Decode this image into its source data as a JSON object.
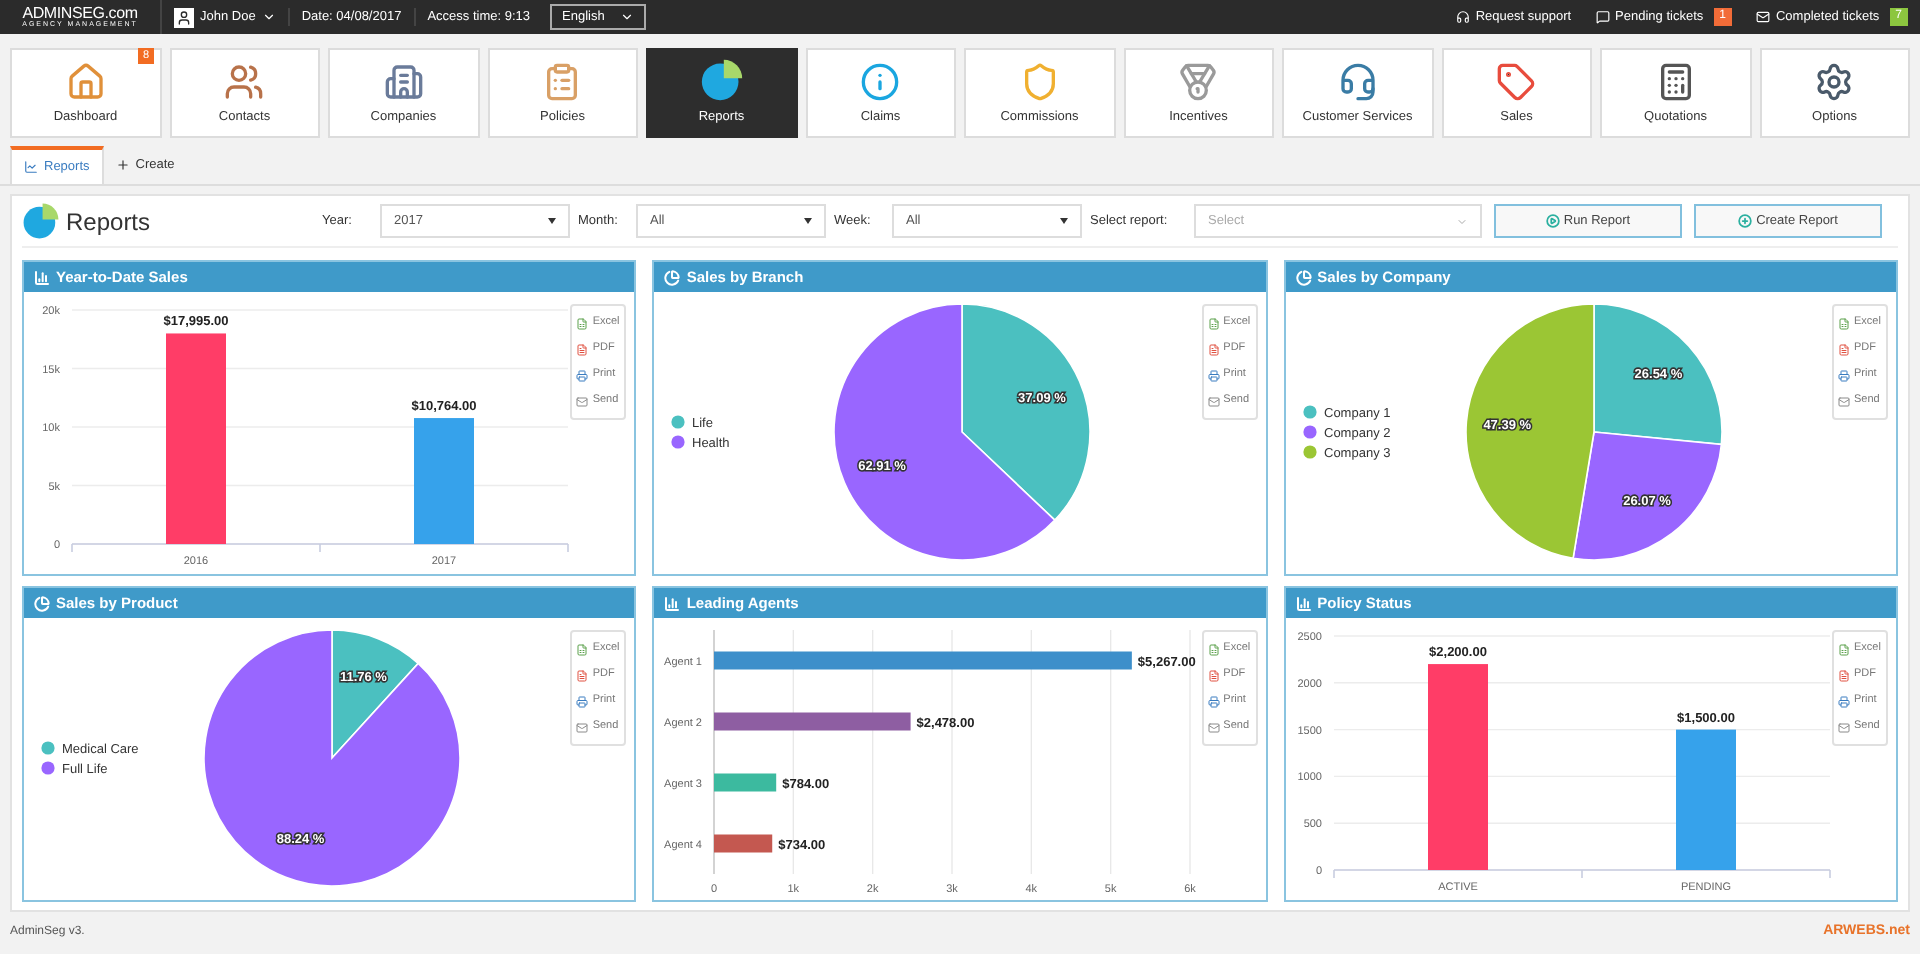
{
  "top_bar": {
    "logo": {
      "name": "ADMINSEG.com",
      "tagline": "AGENCY MANAGEMENT"
    },
    "user": "John Doe",
    "date": "Date: 04/08/2017",
    "access_time": "Access time: 9:13",
    "language": "English",
    "links": [
      {
        "label": "Request support"
      },
      {
        "label": "Pending tickets",
        "badge": "1",
        "color": "#f26c38"
      },
      {
        "label": "Completed tickets",
        "badge": "7",
        "color": "#8cc63f"
      }
    ]
  },
  "modules": [
    {
      "label": "Dashboard",
      "selected": false,
      "badge": "8"
    },
    {
      "label": "Contacts",
      "selected": false
    },
    {
      "label": "Companies",
      "selected": false
    },
    {
      "label": "Policies",
      "selected": false
    },
    {
      "label": "Reports",
      "selected": true
    },
    {
      "label": "Claims",
      "selected": false
    },
    {
      "label": "Commissions",
      "selected": false
    },
    {
      "label": "Incentives",
      "selected": false
    },
    {
      "label": "Customer Services",
      "selected": false
    },
    {
      "label": "Sales",
      "selected": false
    },
    {
      "label": "Quotations",
      "selected": false
    },
    {
      "label": "Options",
      "selected": false
    }
  ],
  "tabs": [
    {
      "label": "Reports",
      "selected": true
    },
    {
      "label": "Create",
      "selected": false
    }
  ],
  "page": {
    "title": "Reports",
    "filters": [
      {
        "label": "Year:",
        "value": "2017"
      },
      {
        "label": "Month:",
        "value": "All"
      },
      {
        "label": "Week:",
        "value": "All"
      }
    ],
    "report_select": {
      "label": "Select report:",
      "placeholder": "Select"
    },
    "buttons": [
      "Run Report",
      "Create Report"
    ]
  },
  "charts": [
    {
      "title": "Year-to-Date Sales",
      "export_options": [
        "Excel",
        "PDF",
        "Print",
        "Send"
      ],
      "chart_data": {
        "type": "bar",
        "grid": true,
        "categories": [
          "2016",
          "2017"
        ],
        "values": [
          17995,
          10764
        ],
        "colors": [
          "#ff3d67",
          "#36a2eb"
        ],
        "ylim": [
          0,
          20000
        ],
        "yticks": [
          {
            "value": 0,
            "label": "0"
          },
          {
            "value": 5000,
            "label": "5k"
          },
          {
            "value": 10000,
            "label": "10k"
          },
          {
            "value": 15000,
            "label": "15k"
          },
          {
            "value": 20000,
            "label": "20k"
          }
        ],
        "value_labels": [
          "$17,995.00",
          "$10,764.00"
        ]
      }
    },
    {
      "title": "Sales by Branch",
      "export_options": [
        "Excel",
        "PDF",
        "Print",
        "Send"
      ],
      "chart_data": {
        "type": "pie",
        "legend": "left",
        "categories": [
          "Life",
          "Health"
        ],
        "values": [
          37.09,
          62.91
        ],
        "colors": [
          "#4bc0c0",
          "#9966ff"
        ],
        "value_labels": [
          "37.09 %",
          "62.91 %"
        ]
      }
    },
    {
      "title": "Sales by Company",
      "export_options": [
        "Excel",
        "PDF",
        "Print",
        "Send"
      ],
      "chart_data": {
        "type": "pie",
        "legend": "left",
        "categories": [
          "Company 1",
          "Company 2",
          "Company 3"
        ],
        "values": [
          26.54,
          26.07,
          47.39
        ],
        "colors": [
          "#4bc0c0",
          "#9966ff",
          "#9bc634"
        ],
        "value_labels": [
          "26.54 %",
          "26.07 %",
          "47.39 %"
        ]
      }
    },
    {
      "title": "Sales by Product",
      "export_options": [
        "Excel",
        "PDF",
        "Print",
        "Send"
      ],
      "chart_data": {
        "type": "pie",
        "legend": "left",
        "categories": [
          "Medical Care",
          "Full Life"
        ],
        "values": [
          11.76,
          88.24
        ],
        "colors": [
          "#4bc0c0",
          "#9966ff"
        ],
        "value_labels": [
          "11.76 %",
          "88.24 %"
        ]
      }
    },
    {
      "title": "Leading Agents",
      "export_options": [
        "Excel",
        "PDF",
        "Print",
        "Send"
      ],
      "chart_data": {
        "type": "bar",
        "grid": true,
        "orientation": "horizontal",
        "categories": [
          "Agent 1",
          "Agent 2",
          "Agent 3",
          "Agent 4"
        ],
        "values": [
          5267,
          2478,
          784,
          734
        ],
        "colors": [
          "#3d8fca",
          "#8e5ea2",
          "#3cba9f",
          "#c45850"
        ],
        "xlim": [
          0,
          6000
        ],
        "xticks": [
          {
            "value": 0,
            "label": "0"
          },
          {
            "value": 1000,
            "label": "1k"
          },
          {
            "value": 2000,
            "label": "2k"
          },
          {
            "value": 3000,
            "label": "3k"
          },
          {
            "value": 4000,
            "label": "4k"
          },
          {
            "value": 5000,
            "label": "5k"
          },
          {
            "value": 6000,
            "label": "6k"
          }
        ],
        "value_labels": [
          "$5,267.00",
          "$2,478.00",
          "$784.00",
          "$734.00"
        ]
      }
    },
    {
      "title": "Policy Status",
      "export_options": [
        "Excel",
        "PDF",
        "Print",
        "Send"
      ],
      "chart_data": {
        "type": "bar",
        "grid": true,
        "categories": [
          "ACTIVE",
          "PENDING"
        ],
        "values": [
          2200,
          1500
        ],
        "colors": [
          "#ff3d67",
          "#36a2eb"
        ],
        "ylim": [
          0,
          2500
        ],
        "yticks": [
          0,
          500,
          1000,
          1500,
          2000,
          2500
        ],
        "value_labels": [
          "$2,200.00",
          "$1,500.00"
        ]
      }
    }
  ],
  "footer": {
    "version": "AdminSeg v3.",
    "brand": "ARWEBS.net"
  }
}
